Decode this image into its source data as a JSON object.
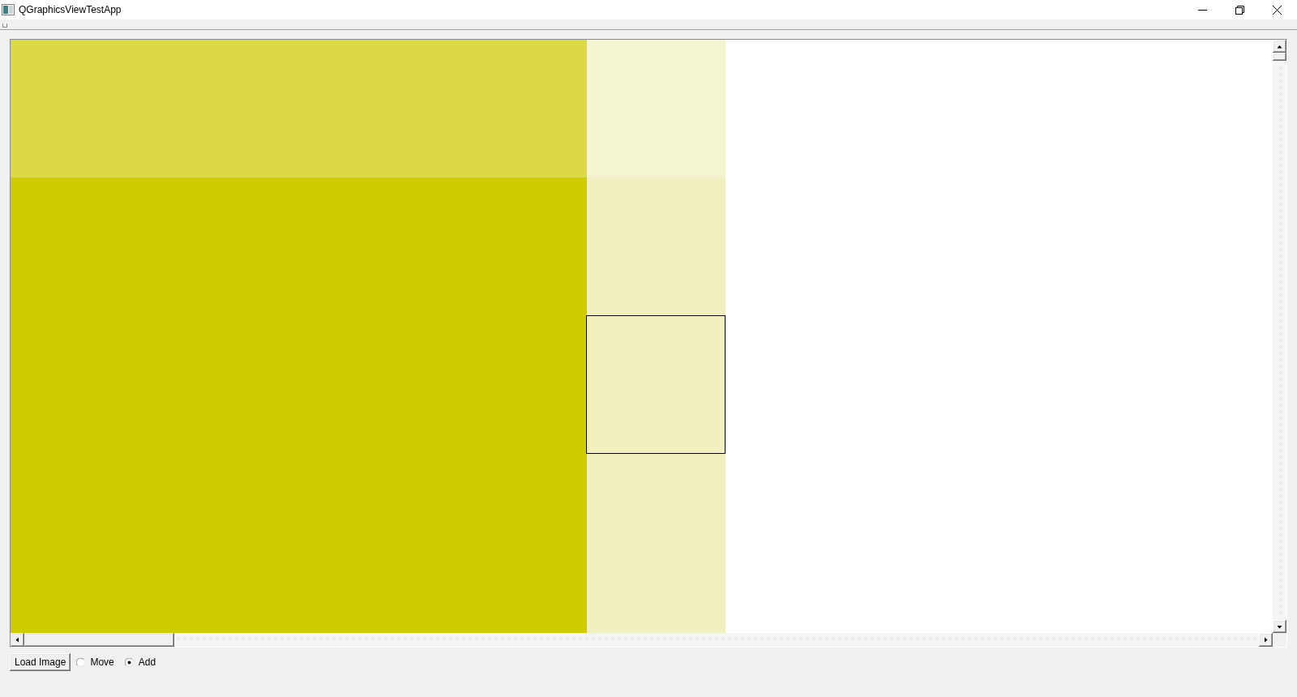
{
  "window": {
    "title": "QGraphicsViewTestApp"
  },
  "scene": {
    "items": [
      {
        "kind": "image"
      },
      {
        "kind": "rectangle"
      }
    ]
  },
  "controls": {
    "load_button": "Load Image",
    "modes": [
      {
        "label": "Move",
        "selected": false
      },
      {
        "label": "Add",
        "selected": true
      }
    ]
  }
}
